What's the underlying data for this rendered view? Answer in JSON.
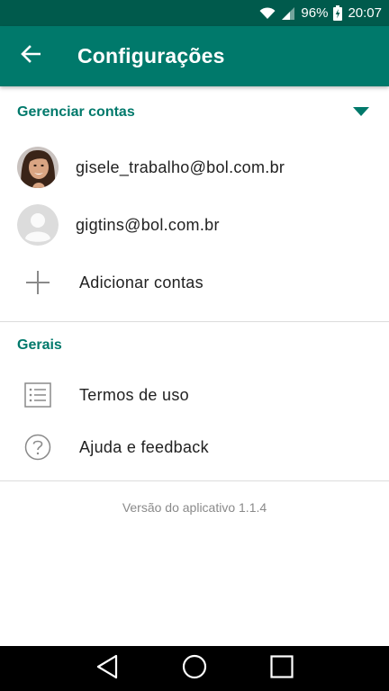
{
  "status_bar": {
    "battery_percent": "96%",
    "time": "20:07",
    "icons": [
      "wifi-icon",
      "cellular-signal-icon",
      "battery-charging-icon"
    ]
  },
  "app_bar": {
    "title": "Configurações",
    "back_icon": "arrow-back-icon"
  },
  "manage_accounts": {
    "header": "Gerenciar contas",
    "toggle_icon": "triangle-down-icon",
    "accounts": [
      {
        "email": "gisele_trabalho@bol.com.br",
        "avatar": "photo-avatar"
      },
      {
        "email": "gigtins@bol.com.br",
        "avatar": "default-avatar"
      }
    ],
    "add_label": "Adicionar contas",
    "add_icon": "plus-icon"
  },
  "general": {
    "header": "Gerais",
    "items": [
      {
        "label": "Termos de uso",
        "icon": "list-icon"
      },
      {
        "label": "Ajuda e feedback",
        "icon": "help-icon"
      }
    ]
  },
  "footer": {
    "version": "Versão do aplicativo 1.1.4"
  },
  "nav_bar": {
    "icons": [
      "nav-back-icon",
      "nav-home-icon",
      "nav-recents-icon"
    ]
  },
  "colors": {
    "status_bar": "#005a4c",
    "app_bar": "#00796b",
    "accent": "#00796b"
  }
}
